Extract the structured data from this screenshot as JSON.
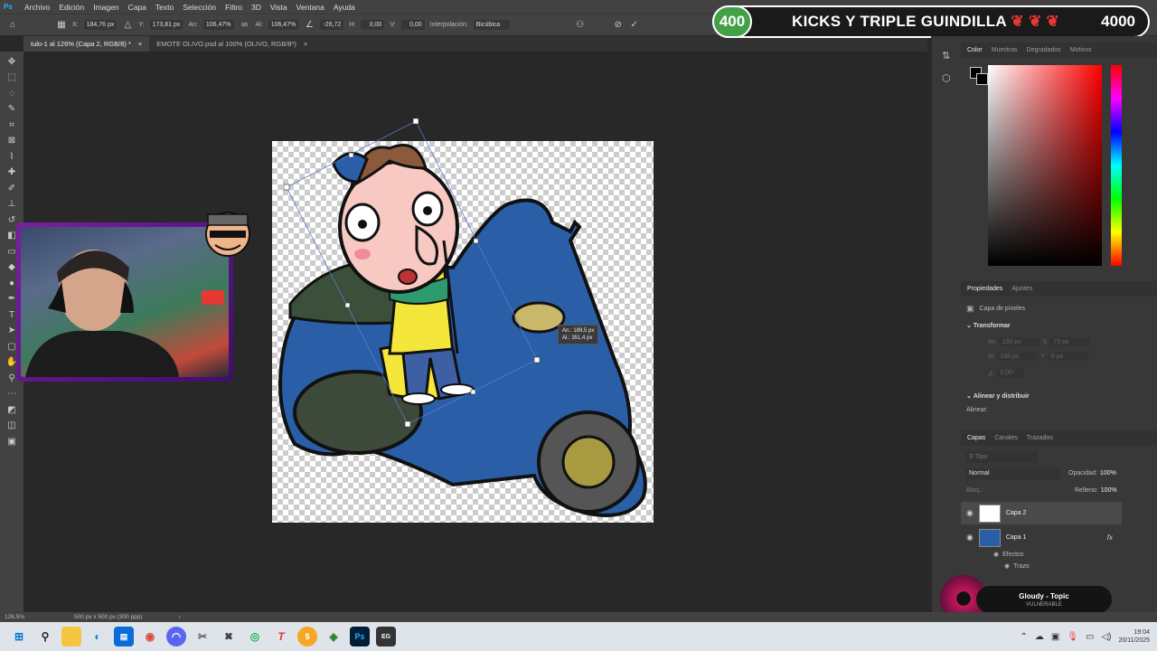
{
  "menubar": {
    "logo": "Ps",
    "items": [
      "Archivo",
      "Edición",
      "Imagen",
      "Capa",
      "Texto",
      "Selección",
      "Filtro",
      "3D",
      "Vista",
      "Ventana",
      "Ayuda"
    ]
  },
  "options": {
    "x_label": "X:",
    "x_value": "184,76 px",
    "y_label": "Y:",
    "y_value": "173,81 px",
    "w_label": "An:",
    "w_value": "106,47%",
    "h_label": "Al:",
    "h_value": "106,47%",
    "angle_value": "-26,72",
    "hskew_label": "H:",
    "hskew_value": "0,00",
    "vskew_label": "V:",
    "vskew_value": "0,00",
    "interp_label": "Interpolación:",
    "interp_value": "Bicúbica"
  },
  "tabs": [
    {
      "label": "tulo-1 al 126% (Capa 2, RGB/8) *",
      "close": "×"
    },
    {
      "label": "EMOTE OLIVO.psd al 100% (OLIVO, RGB/8*)",
      "close": "×"
    }
  ],
  "overlay": {
    "current": "400",
    "title": "KICKS Y TRIPLE GUINDILLA",
    "goal": "4000"
  },
  "tooltip": {
    "w": "An.:  189,5 px",
    "h": "Al.:  351,4 px"
  },
  "color_panel": {
    "tabs": [
      "Color",
      "Muestras",
      "Degradados",
      "Motivos"
    ]
  },
  "props_panel": {
    "tabs": [
      "Propiedades",
      "Ajustes"
    ],
    "layer_type": "Capa de píxeles",
    "transform_label": "Transformar",
    "an_label": "An",
    "an_value": "190 px",
    "x_label": "X",
    "x_value": "73 px",
    "al_label": "Al",
    "al_value": "338 px",
    "y_label": "Y",
    "y_value": "6 px",
    "angle_value": "0,00°",
    "align_label": "Alinear y distribuir",
    "align_sub": "Alinear:"
  },
  "layers_panel": {
    "tabs": [
      "Capas",
      "Canales",
      "Trazados"
    ],
    "search_placeholder": "Tipo",
    "blend_mode": "Normal",
    "opacity_label": "Opacidad:",
    "opacity_value": "100%",
    "lock_label": "Bloq.:",
    "fill_label": "Relleno:",
    "fill_value": "100%",
    "layers": [
      {
        "name": "Capa 2"
      },
      {
        "name": "Capa 1",
        "fx": "fx"
      }
    ],
    "effects_label": "Efectos",
    "stroke_label": "Trazo"
  },
  "music": {
    "artist": "Gloudy - Topic",
    "track": "VULNERABLE"
  },
  "status": {
    "zoom": "126,5%",
    "doc_size": "500 px x 500 px (300 ppp)"
  },
  "clock": {
    "time": "19:04",
    "date": "20/11/2025"
  },
  "colors": {
    "accent": "#31a8ff",
    "badge_green": "#43a047",
    "webcam_border": "#7b1fa2",
    "scooter_blue": "#2a5fa8",
    "shirt_yellow": "#f5e63c"
  }
}
